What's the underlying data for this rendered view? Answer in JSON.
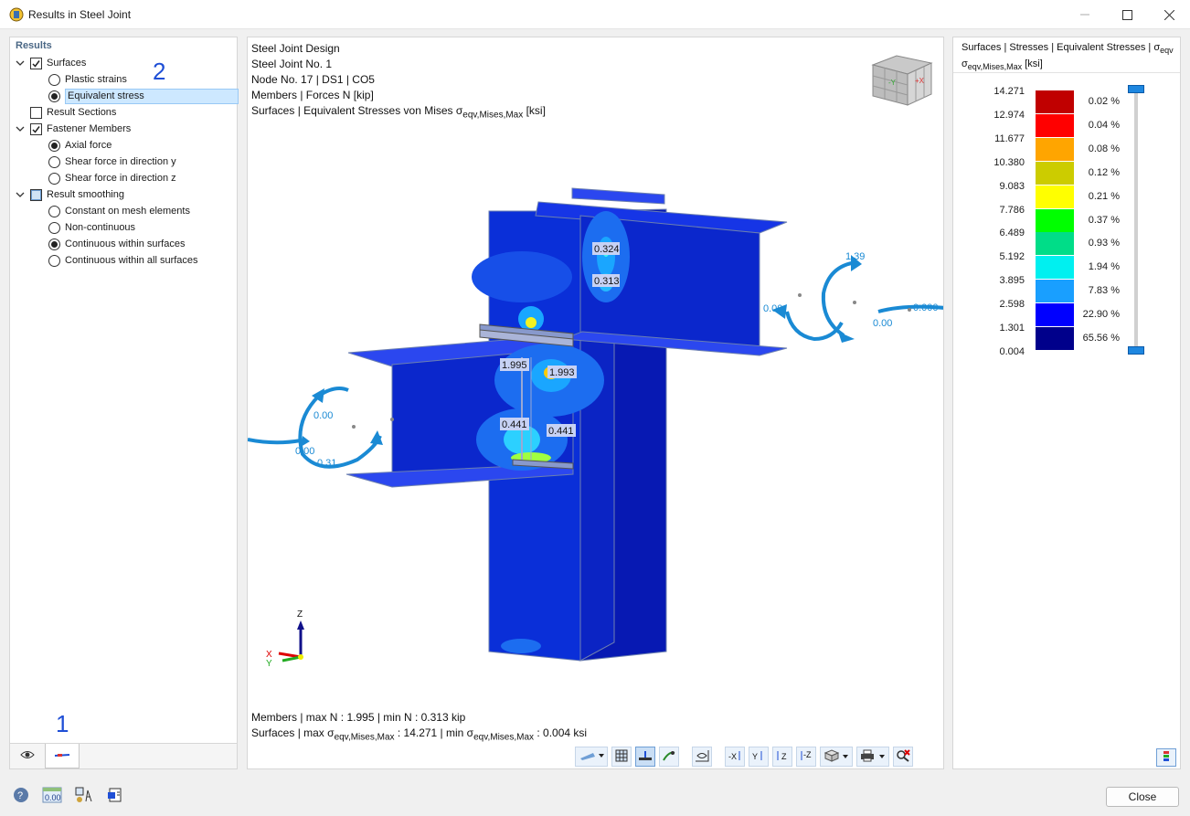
{
  "window": {
    "title": "Results in Steel Joint"
  },
  "tree": {
    "header": "Results",
    "surfaces": "Surfaces",
    "plastic_strains": "Plastic strains",
    "equivalent_stress": "Equivalent stress",
    "result_sections": "Result Sections",
    "fastener_members": "Fastener Members",
    "axial_force": "Axial force",
    "shear_y": "Shear force in direction y",
    "shear_z": "Shear force in direction z",
    "result_smoothing": "Result smoothing",
    "constant_mesh": "Constant on mesh elements",
    "non_continuous": "Non-continuous",
    "continuous_within": "Continuous within surfaces",
    "continuous_all": "Continuous within all surfaces"
  },
  "markers": {
    "one": "1",
    "two": "2"
  },
  "viewport": {
    "line1": "Steel Joint Design",
    "line2": "Steel Joint No. 1",
    "line3": "Node No. 17 | DS1 | CO5",
    "line4": "Members | Forces N [kip]",
    "line5_prefix": "Surfaces | Equivalent Stresses von Mises σ",
    "line5_sub": "eqv,Mises,Max",
    "line5_unit": " [ksi]",
    "footer1": "Members | max N : 1.995 | min N : 0.313 kip",
    "footer2_a": "Surfaces | max σ",
    "footer2_sub1": "eqv,Mises,Max",
    "footer2_b": " : 14.271 | min σ",
    "footer2_sub2": "eqv,Mises,Max",
    "footer2_c": " : 0.004 ksi",
    "labels": {
      "v0324": "0.324",
      "v0313": "0.313",
      "v1995": "1.995",
      "v1993": "1.993",
      "v0441a": "0.441",
      "v0441b": "0.441"
    },
    "moments": {
      "left_top": "0.00",
      "left_mid": "0.00",
      "left_bot": "0.31",
      "right_top": "1.39",
      "right_mid": "0.00",
      "right_bot": "0.00",
      "right_far": "0.000"
    },
    "axes": {
      "z": "Z",
      "x": "X",
      "y": "Y"
    }
  },
  "legend": {
    "title_a": "Surfaces | Stresses | Equivalent Stresses | σ",
    "title_sub1": "eqv",
    "title_line2_a": "σ",
    "title_line2_sub": "eqv,Mises,Max",
    "title_line2_b": " [ksi]",
    "values": [
      "14.271",
      "12.974",
      "11.677",
      "10.380",
      "9.083",
      "7.786",
      "6.489",
      "5.192",
      "3.895",
      "2.598",
      "1.301",
      "0.004"
    ],
    "colors": [
      "#c00000",
      "#ff0000",
      "#ffa500",
      "#cccc00",
      "#ffff00",
      "#00ff00",
      "#00dd88",
      "#00f0f0",
      "#199fff",
      "#0000ff",
      "#00008b"
    ],
    "percents": [
      "0.02 %",
      "0.04 %",
      "0.08 %",
      "0.12 %",
      "0.21 %",
      "0.37 %",
      "0.93 %",
      "1.94 %",
      "7.83 %",
      "22.90 %",
      "65.56 %"
    ]
  },
  "footer": {
    "close": "Close"
  }
}
